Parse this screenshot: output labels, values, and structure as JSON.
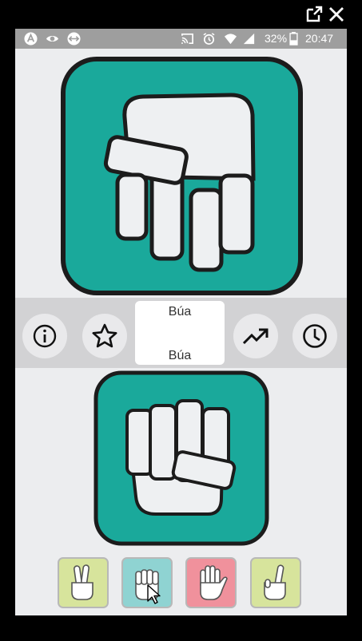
{
  "status_bar": {
    "battery": "32%",
    "time": "20:47"
  },
  "top_card": {
    "hand": "rock",
    "color": "#1aa99b"
  },
  "toolbar": {
    "info_icon": "info-icon",
    "star_icon": "star-icon",
    "trend_icon": "trending-up-icon",
    "history_icon": "clock-icon",
    "result_top": "Búa",
    "result_bottom": "Búa"
  },
  "bottom_card": {
    "hand": "rock",
    "color": "#1aa99b"
  },
  "choices": [
    {
      "name": "scissors",
      "color": "#d7e49c"
    },
    {
      "name": "rock",
      "color": "#8fd3d2"
    },
    {
      "name": "paper",
      "color": "#f0919c"
    },
    {
      "name": "one-finger",
      "color": "#d7e49c"
    }
  ]
}
